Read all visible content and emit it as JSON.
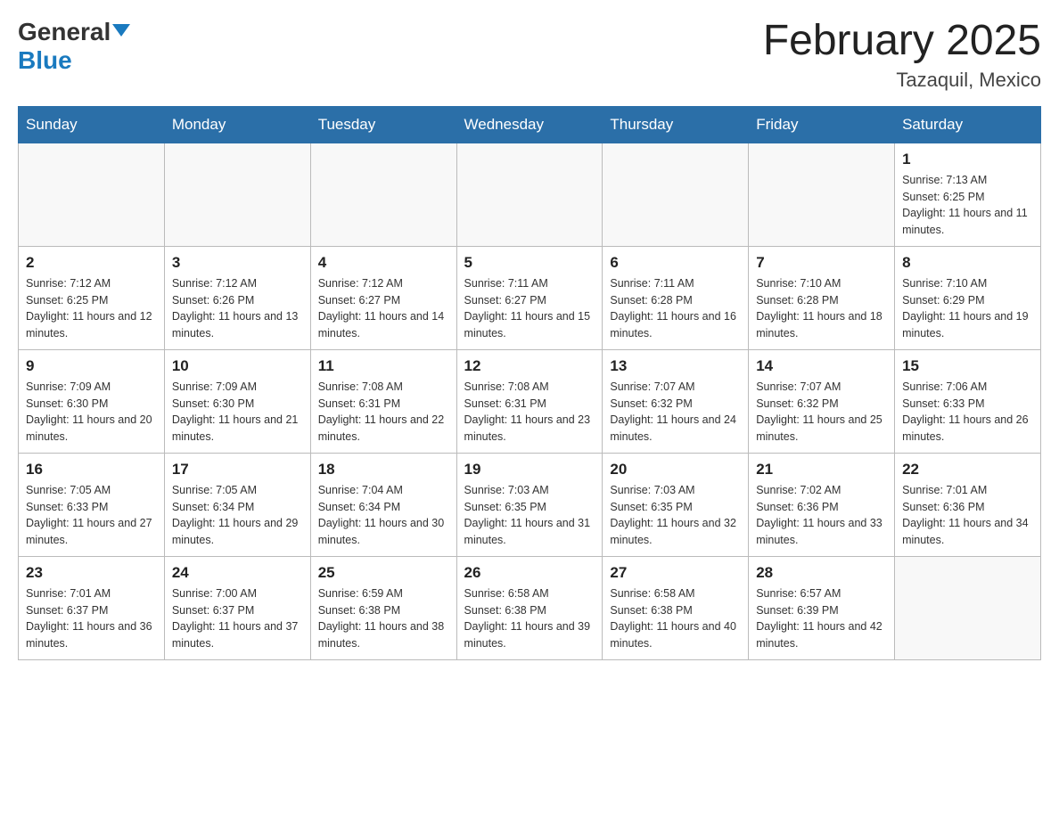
{
  "header": {
    "logo_general": "General",
    "logo_blue": "Blue",
    "month_title": "February 2025",
    "location": "Tazaquil, Mexico"
  },
  "weekdays": [
    "Sunday",
    "Monday",
    "Tuesday",
    "Wednesday",
    "Thursday",
    "Friday",
    "Saturday"
  ],
  "weeks": [
    [
      {
        "day": "",
        "info": ""
      },
      {
        "day": "",
        "info": ""
      },
      {
        "day": "",
        "info": ""
      },
      {
        "day": "",
        "info": ""
      },
      {
        "day": "",
        "info": ""
      },
      {
        "day": "",
        "info": ""
      },
      {
        "day": "1",
        "info": "Sunrise: 7:13 AM\nSunset: 6:25 PM\nDaylight: 11 hours and 11 minutes."
      }
    ],
    [
      {
        "day": "2",
        "info": "Sunrise: 7:12 AM\nSunset: 6:25 PM\nDaylight: 11 hours and 12 minutes."
      },
      {
        "day": "3",
        "info": "Sunrise: 7:12 AM\nSunset: 6:26 PM\nDaylight: 11 hours and 13 minutes."
      },
      {
        "day": "4",
        "info": "Sunrise: 7:12 AM\nSunset: 6:27 PM\nDaylight: 11 hours and 14 minutes."
      },
      {
        "day": "5",
        "info": "Sunrise: 7:11 AM\nSunset: 6:27 PM\nDaylight: 11 hours and 15 minutes."
      },
      {
        "day": "6",
        "info": "Sunrise: 7:11 AM\nSunset: 6:28 PM\nDaylight: 11 hours and 16 minutes."
      },
      {
        "day": "7",
        "info": "Sunrise: 7:10 AM\nSunset: 6:28 PM\nDaylight: 11 hours and 18 minutes."
      },
      {
        "day": "8",
        "info": "Sunrise: 7:10 AM\nSunset: 6:29 PM\nDaylight: 11 hours and 19 minutes."
      }
    ],
    [
      {
        "day": "9",
        "info": "Sunrise: 7:09 AM\nSunset: 6:30 PM\nDaylight: 11 hours and 20 minutes."
      },
      {
        "day": "10",
        "info": "Sunrise: 7:09 AM\nSunset: 6:30 PM\nDaylight: 11 hours and 21 minutes."
      },
      {
        "day": "11",
        "info": "Sunrise: 7:08 AM\nSunset: 6:31 PM\nDaylight: 11 hours and 22 minutes."
      },
      {
        "day": "12",
        "info": "Sunrise: 7:08 AM\nSunset: 6:31 PM\nDaylight: 11 hours and 23 minutes."
      },
      {
        "day": "13",
        "info": "Sunrise: 7:07 AM\nSunset: 6:32 PM\nDaylight: 11 hours and 24 minutes."
      },
      {
        "day": "14",
        "info": "Sunrise: 7:07 AM\nSunset: 6:32 PM\nDaylight: 11 hours and 25 minutes."
      },
      {
        "day": "15",
        "info": "Sunrise: 7:06 AM\nSunset: 6:33 PM\nDaylight: 11 hours and 26 minutes."
      }
    ],
    [
      {
        "day": "16",
        "info": "Sunrise: 7:05 AM\nSunset: 6:33 PM\nDaylight: 11 hours and 27 minutes."
      },
      {
        "day": "17",
        "info": "Sunrise: 7:05 AM\nSunset: 6:34 PM\nDaylight: 11 hours and 29 minutes."
      },
      {
        "day": "18",
        "info": "Sunrise: 7:04 AM\nSunset: 6:34 PM\nDaylight: 11 hours and 30 minutes."
      },
      {
        "day": "19",
        "info": "Sunrise: 7:03 AM\nSunset: 6:35 PM\nDaylight: 11 hours and 31 minutes."
      },
      {
        "day": "20",
        "info": "Sunrise: 7:03 AM\nSunset: 6:35 PM\nDaylight: 11 hours and 32 minutes."
      },
      {
        "day": "21",
        "info": "Sunrise: 7:02 AM\nSunset: 6:36 PM\nDaylight: 11 hours and 33 minutes."
      },
      {
        "day": "22",
        "info": "Sunrise: 7:01 AM\nSunset: 6:36 PM\nDaylight: 11 hours and 34 minutes."
      }
    ],
    [
      {
        "day": "23",
        "info": "Sunrise: 7:01 AM\nSunset: 6:37 PM\nDaylight: 11 hours and 36 minutes."
      },
      {
        "day": "24",
        "info": "Sunrise: 7:00 AM\nSunset: 6:37 PM\nDaylight: 11 hours and 37 minutes."
      },
      {
        "day": "25",
        "info": "Sunrise: 6:59 AM\nSunset: 6:38 PM\nDaylight: 11 hours and 38 minutes."
      },
      {
        "day": "26",
        "info": "Sunrise: 6:58 AM\nSunset: 6:38 PM\nDaylight: 11 hours and 39 minutes."
      },
      {
        "day": "27",
        "info": "Sunrise: 6:58 AM\nSunset: 6:38 PM\nDaylight: 11 hours and 40 minutes."
      },
      {
        "day": "28",
        "info": "Sunrise: 6:57 AM\nSunset: 6:39 PM\nDaylight: 11 hours and 42 minutes."
      },
      {
        "day": "",
        "info": ""
      }
    ]
  ]
}
